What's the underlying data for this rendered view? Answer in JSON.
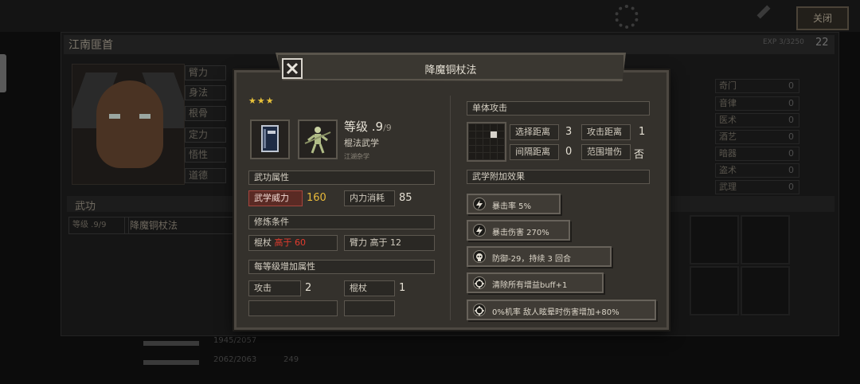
{
  "background": {
    "close_button": "关闭",
    "character_name": "江南匪首",
    "exp_text": "EXP 3/3250",
    "exp_level": "22",
    "stats": [
      "臂力",
      "身法",
      "根骨",
      "定力",
      "悟性",
      "道德"
    ],
    "wugong_header": "武功",
    "equipped_level": "等级 .9/9",
    "equipped_name": "降魔铜杖法",
    "skills": [
      {
        "label": "奇门",
        "value": "0"
      },
      {
        "label": "音律",
        "value": "0"
      },
      {
        "label": "医术",
        "value": "0"
      },
      {
        "label": "酒艺",
        "value": "0"
      },
      {
        "label": "暗器",
        "value": "0"
      },
      {
        "label": "盗术",
        "value": "0"
      },
      {
        "label": "武理",
        "value": "0"
      }
    ],
    "hp_text": "1945/2057",
    "mp_text": "2062/2063",
    "mp_extra": "249"
  },
  "modal": {
    "title": "降魔铜杖法",
    "stars": "★★★",
    "level_label": "等级 .9",
    "level_max": "/9",
    "type": "棍法武学",
    "origin": "江湖杂学",
    "attr_header": "武功属性",
    "power_label": "武学威力",
    "power_value": "160",
    "neili_label": "内力消耗",
    "neili_value": "85",
    "req_header": "修炼条件",
    "req1_label": "棍杖",
    "req1_cond": "高于 60",
    "req2_label": "臂力 高于 12",
    "per_level_header": "每等级增加属性",
    "inc1_label": "攻击",
    "inc1_value": "2",
    "inc2_label": "棍杖",
    "inc2_value": "1",
    "attack_type": "单体攻击",
    "select_range_label": "选择距离",
    "select_range_value": "3",
    "attack_range_label": "攻击距离",
    "attack_range_value": "1",
    "gap_range_label": "间隔距离",
    "gap_range_value": "0",
    "area_boost_label": "范围增伤",
    "area_boost_value": "否",
    "extra_header": "武学附加效果",
    "effects": [
      {
        "icon": "lightning-icon",
        "text": "暴击率 5%"
      },
      {
        "icon": "lightning-icon",
        "text": "暴击伤害 270%"
      },
      {
        "icon": "skull-icon",
        "text": "防御-29，持续 3 回合"
      },
      {
        "icon": "target-icon",
        "text": "清除所有增益buff+1"
      },
      {
        "icon": "target-icon",
        "text": "0%机率 敌人眩晕时伤害增加+80%"
      }
    ]
  },
  "colors": {
    "gold": "#e8b93a",
    "red": "#e23b2e",
    "star": "#e8c23a"
  }
}
